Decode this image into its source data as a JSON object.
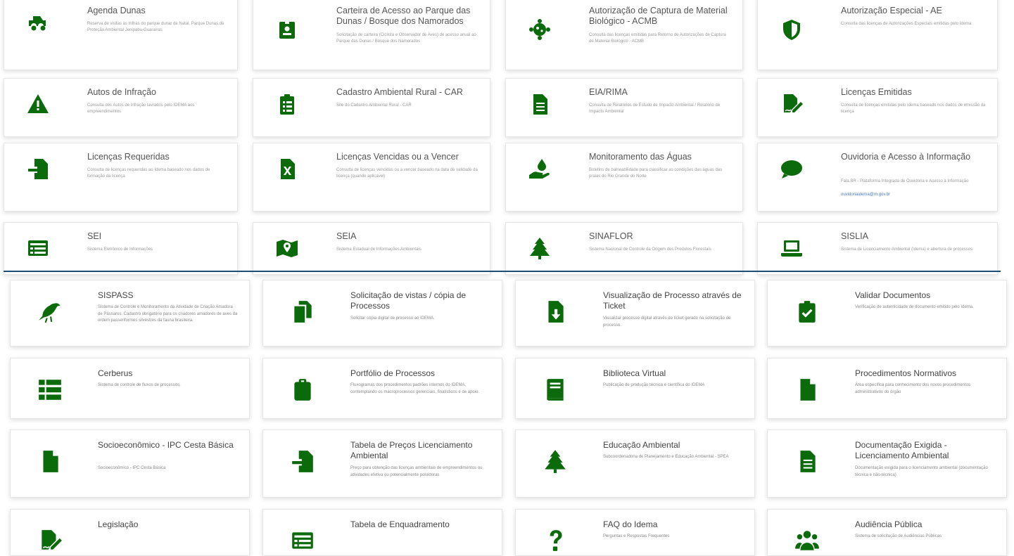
{
  "accent_color": "#0b6b0b",
  "top": [
    {
      "title": "Agenda Dunas",
      "desc": "Reserva de visitas às trilhas do parque dunar de Natal. Parque Dunas de Proteção Ambiental Jenipabu-Guaraíras",
      "icon": "truck-icon"
    },
    {
      "title": "Carteira de Acesso ao Parque das Dunas / Bosque dos Namorados",
      "desc": "Solicitação de carteira (Ciclista e Observador de Aves) de acesso anual ao Parque das Dunas / Bosque dos Namorados",
      "icon": "id-badge-icon"
    },
    {
      "title": "Autorização de Captura de Material Biológico - ACMB",
      "desc": "Consulta das licenças emitidas para Retorno de Autorizações de Captura de Material Biológico - ACMB",
      "icon": "virus-icon"
    },
    {
      "title": "Autorização Especial - AE",
      "desc": "Consulta das licenças de Autorizações Especiais emitidas pelo Idema",
      "icon": "shield-icon"
    },
    {
      "title": "Autos de Infração",
      "desc": "Consulta dos Autos de Infração lavrados pelo IDEMA aos empreendimentos",
      "icon": "warning-icon"
    },
    {
      "title": "Cadastro Ambiental Rural - CAR",
      "desc": "Site do Cadastro Ambiental Rural - CAR",
      "icon": "clipboard-list-icon"
    },
    {
      "title": "EIA/RIMA",
      "desc": "Consulta de Relatórios de Estudo de Impacto Ambiental / Relatório de Impacto Ambiental",
      "icon": "file-text-icon"
    },
    {
      "title": "Licenças Emitidas",
      "desc": "Consulta de licenças emitidas pelo Idema baseado nos dados de emissão da licença",
      "icon": "file-signature-icon"
    },
    {
      "title": "Licenças Requeridas",
      "desc": "Consulta de licenças requeridas ao Idema baseado nos dados de formação da licença",
      "icon": "file-import-icon"
    },
    {
      "title": "Licenças Vencidas ou a Vencer",
      "desc": "Consulta de licenças vencidas ou a vencer baseado na data de validade da licença (quando aplicável)",
      "icon": "file-excel-icon"
    },
    {
      "title": "Monitoramento das Águas",
      "desc": "Boletins de balneabilidade para classificar as condições das águas das praias do Rio Grande do Norte",
      "icon": "hand-water-icon"
    },
    {
      "title": "Ouvidoria e Acesso à Informação",
      "desc": "Fala.BR - Plataforma Integrada de Ouvidoria e Acesso à Informação",
      "icon": "comment-icon",
      "link": "ouvidoriaidema@rn.gov.br"
    },
    {
      "title": "SEI",
      "desc": "Sistema Eletrônico de Informações",
      "icon": "list-alt-icon"
    },
    {
      "title": "SEIA",
      "desc": "Sistema Estadual de Informações Ambientais",
      "icon": "map-icon"
    },
    {
      "title": "SINAFLOR",
      "desc": "Sistema Nacional de Controle da Origem dos Produtos Florestais",
      "icon": "tree-icon"
    },
    {
      "title": "SISLIA",
      "desc": "Sistema de Licenciamento Ambiental (Idema) e abertura de processos",
      "icon": "laptop-icon"
    }
  ],
  "bottom": [
    {
      "title": "SISPASS",
      "desc": "Sistema de Controle e Monitoramento da Atividade de Criação Amadora de Pássaros. Cadastro obrigatório para os criadores amadores de aves da ordem passeriformes silvestres da fauna brasileira.",
      "icon": "crow-icon"
    },
    {
      "title": "Solicitação de vistas / cópia de Processos",
      "desc": "Solicitar cópia digital de processo ao IDEMA.",
      "icon": "copy-icon"
    },
    {
      "title": "Visualização de Processo através de Ticket",
      "desc": "Visualizar processo digital através do ticket gerado na solicitação de processo.",
      "icon": "file-download-icon"
    },
    {
      "title": "Validar Documentos",
      "desc": "Verificação de autenticidade de documento emitido pelo Idema.",
      "icon": "clipboard-check-icon"
    },
    {
      "title": "Cerberus",
      "desc": "Sistema de controle de fluxos de processos.",
      "icon": "th-list-icon"
    },
    {
      "title": "Portfólio de Processos",
      "desc": "Fluxogramas dos procedimentos padrões internos do IDEMA, contemplando os macroprocessos gerenciais, finalísticos e de apoio.",
      "icon": "clipboard-icon"
    },
    {
      "title": "Biblioteca Virtual",
      "desc": "Publicação de produção técnica e científica do IDEMA",
      "icon": "book-icon"
    },
    {
      "title": "Procedimentos Normativos",
      "desc": "Área específica para conhecimento dos novos procedimentos administrativos do órgão",
      "icon": "file-icon"
    },
    {
      "title": "Socioeconômico - IPC Cesta Básica",
      "desc": "Socioeconômico - IPC Cesta Básica",
      "icon": "file-icon"
    },
    {
      "title": "Tabela de Preços Licenciamento Ambiental",
      "desc": "Preço para obtenção das licenças ambientais de empreendimentos ou atividades efetiva ou potencialmente poluidoras",
      "icon": "file-import-icon"
    },
    {
      "title": "Educação Ambiental",
      "desc": "Subcoordenadoria de Planejamento e Educação Ambiental - SPEA",
      "icon": "tree-icon"
    },
    {
      "title": "Documentação Exigida - Licenciamento Ambiental",
      "desc": "Documentação exigida para o licenciamento ambiental (documentação técnica e não-técnica)",
      "icon": "file-text-icon"
    },
    {
      "title": "Legislação",
      "desc": "",
      "icon": "file-signature-icon"
    },
    {
      "title": "Tabela de Enquadramento",
      "desc": "",
      "icon": "list-alt-icon"
    },
    {
      "title": "FAQ do Idema",
      "desc": "Perguntas e Respostas Frequentes",
      "icon": "question-icon"
    },
    {
      "title": "Audiência Pública",
      "desc": "Sistema de solicitação de Audiências Públicas",
      "icon": "users-icon"
    }
  ]
}
